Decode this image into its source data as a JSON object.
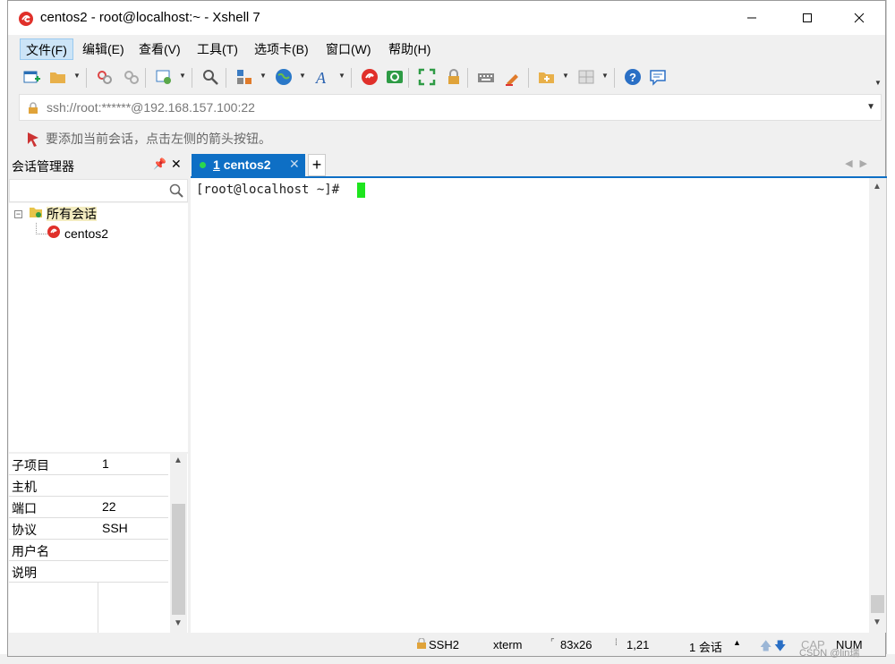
{
  "window": {
    "title": "centos2 - root@localhost:~ - Xshell 7"
  },
  "menu": [
    "文件(F)",
    "编辑(E)",
    "查看(V)",
    "工具(T)",
    "选项卡(B)",
    "窗口(W)",
    "帮助(H)"
  ],
  "address_bar": {
    "text": "ssh://root:******@192.168.157.100:22"
  },
  "hint": {
    "text": "要添加当前会话，点击左侧的箭头按钮。"
  },
  "session_manager": {
    "title": "会话管理器",
    "tree": {
      "root_label": "所有会话",
      "child_label": "centos2"
    }
  },
  "properties": [
    {
      "key": "子项目",
      "value": "1"
    },
    {
      "key": "主机",
      "value": ""
    },
    {
      "key": "端口",
      "value": "22"
    },
    {
      "key": "协议",
      "value": "SSH"
    },
    {
      "key": "用户名",
      "value": ""
    },
    {
      "key": "说明",
      "value": ""
    }
  ],
  "tabs": [
    {
      "number": "1",
      "label": "centos2",
      "active": true
    }
  ],
  "terminal": {
    "prompt": "[root@localhost ~]# "
  },
  "statusbar": {
    "protocol": "SSH2",
    "term": "xterm",
    "size": "83x26",
    "cursor": "1,21",
    "sessions": "1 会话",
    "cap": "CAP",
    "num": "NUM"
  },
  "watermark": "CSDN @lin瑞",
  "colors": {
    "tab_active": "#0e6fc5",
    "cursor": "#1ee51e",
    "menu_highlight": "#cce4f7"
  }
}
